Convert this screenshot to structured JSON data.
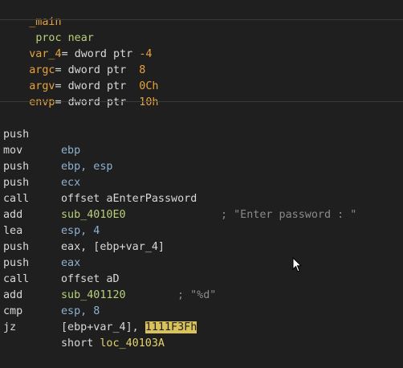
{
  "header": {
    "name": "_main",
    "kw1": "proc",
    "kw2": "near"
  },
  "vars": [
    {
      "name": "var_4",
      "sep": "=",
      "type": "dword ptr",
      "value": "-4"
    },
    {
      "name": "argc",
      "sep": "=",
      "type": "dword ptr",
      "value": " 8"
    },
    {
      "name": "argv",
      "sep": "=",
      "type": "dword ptr",
      "value": " 0Ch"
    },
    {
      "name": "envp",
      "sep": "=",
      "type": "dword ptr",
      "value": " 10h"
    }
  ],
  "code": [
    {
      "op": "push",
      "a": "ebp"
    },
    {
      "op": "mov",
      "a": "ebp, esp"
    },
    {
      "op": "push",
      "a": "ecx"
    },
    {
      "op": "push",
      "a": "offset aEnterPassword",
      "comment": "; \"Enter password : \""
    },
    {
      "op": "call",
      "a": "sub_4010E0"
    },
    {
      "op": "add",
      "a": "esp, 4"
    },
    {
      "op": "lea",
      "a": "eax, [ebp+var_4]"
    },
    {
      "op": "push",
      "a": "eax"
    },
    {
      "op": "push",
      "a": "offset aD",
      "comment": "; \"%d\""
    },
    {
      "op": "call",
      "a": "sub_401120"
    },
    {
      "op": "add",
      "a": "esp, 8"
    },
    {
      "op": "cmp",
      "a1": "[ebp+var_4], ",
      "highlight": "1111F3Fh"
    },
    {
      "op": "jz",
      "a1": "short ",
      "a2": "loc_40103A"
    }
  ]
}
